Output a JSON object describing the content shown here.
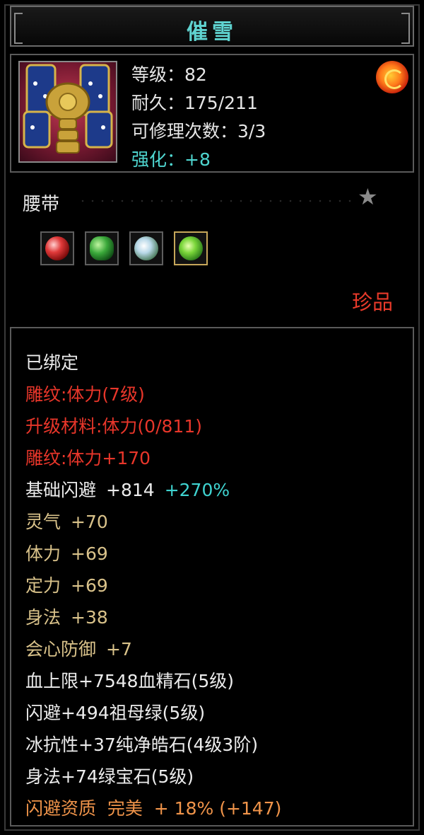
{
  "title": "催雪",
  "header": {
    "item_icon": "armor-belt-icon",
    "stats": [
      {
        "label": "等级：82",
        "color": "white"
      },
      {
        "label": "耐久：175/211",
        "color": "white"
      },
      {
        "label": "可修理次数：3/3",
        "color": "white"
      },
      {
        "label": "强化：+8",
        "color": "cyan"
      }
    ],
    "badge_icon": "dragon-emblem-icon"
  },
  "item_type": "腰带",
  "star_icon": "star-icon",
  "gems": [
    {
      "icon": "red-gem-icon",
      "kind": "red"
    },
    {
      "icon": "jade-ring-icon",
      "kind": "jade"
    },
    {
      "icon": "white-gem-icon",
      "kind": "white"
    },
    {
      "icon": "green-gem-icon",
      "kind": "green"
    }
  ],
  "rarity": "珍品",
  "attributes": {
    "bound": "已绑定",
    "engraving": "雕纹:体力(7级)",
    "upgrade_material": "升级材料:体力(0/811)",
    "engraving_bonus": "雕纹:体力+170",
    "base_dodge": {
      "label": "基础闪避",
      "value": "+814",
      "extra": "+270%"
    },
    "stats": [
      {
        "label": "灵气",
        "value": "+70"
      },
      {
        "label": "体力",
        "value": "+69"
      },
      {
        "label": "定力",
        "value": "+69"
      },
      {
        "label": "身法",
        "value": "+38"
      },
      {
        "label": "会心防御",
        "value": "+7"
      }
    ],
    "gem_bonuses": [
      "血上限+7548血精石(5级)",
      "闪避+494祖母绿(5级)",
      "冰抗性+37纯净皓石(4级3阶)",
      "身法+74绿宝石(5级)"
    ],
    "quality": "闪避资质  完美  + 18% (+147)"
  },
  "colors": {
    "title": "#5fd3d0",
    "red": "#e8362a",
    "tan": "#d9c28a",
    "cyan": "#3fd3d0",
    "orange": "#f0944a"
  }
}
